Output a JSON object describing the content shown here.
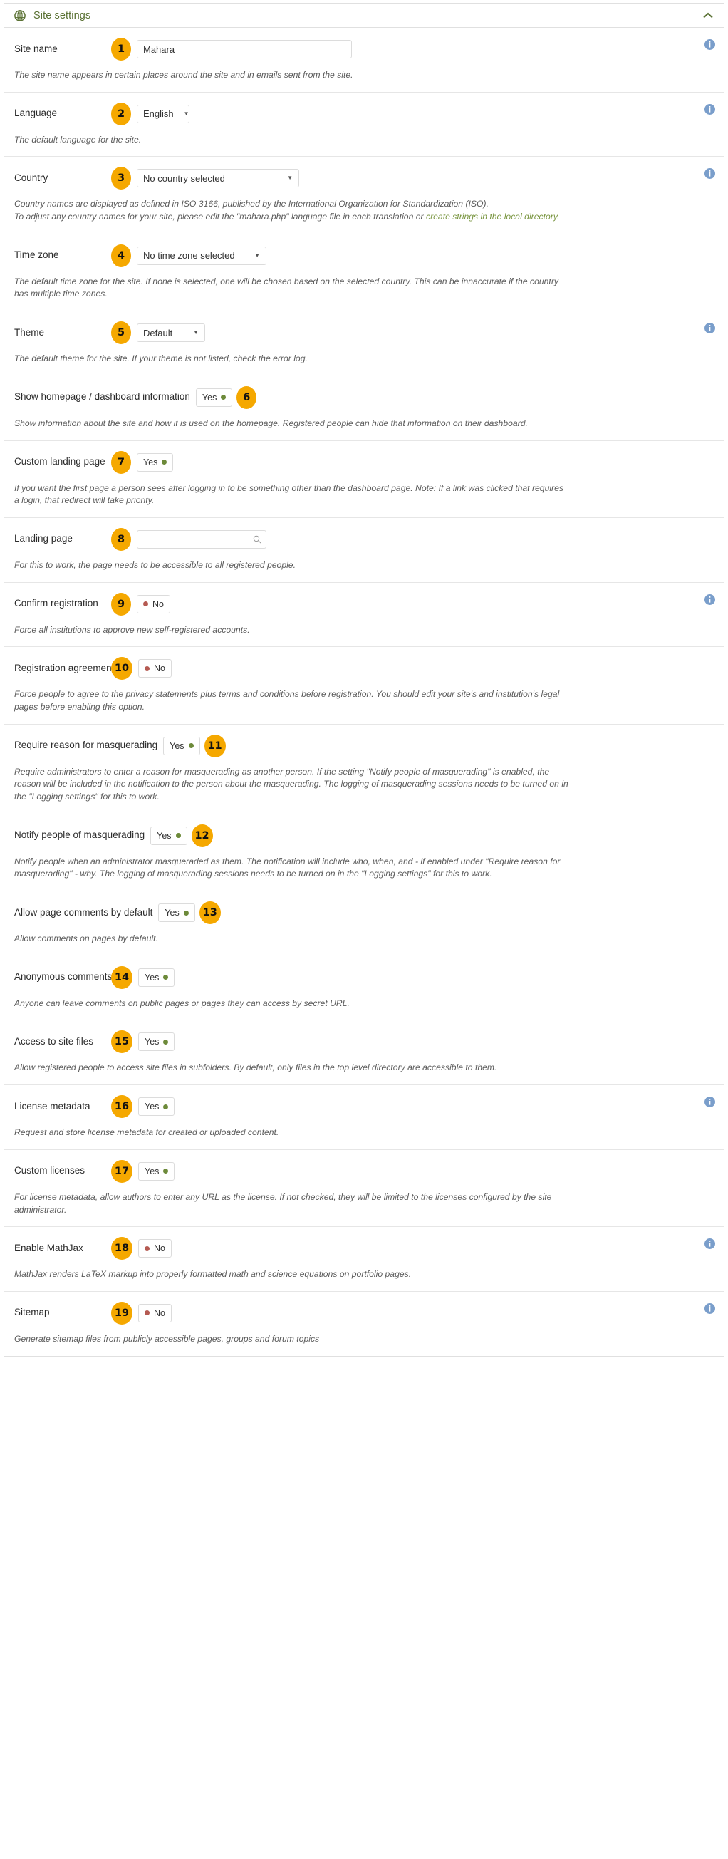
{
  "header": {
    "title": "Site settings",
    "globe_icon": "globe-icon",
    "collapse_icon": "chevron-up-icon"
  },
  "icons": {
    "info": "info-icon",
    "search": "search-icon",
    "caret": "▼"
  },
  "rows": [
    {
      "badge": "1",
      "label": "Site name",
      "control": "text",
      "value": "Mahara",
      "placeholder": "",
      "info": true,
      "help": "The site name appears in certain places around the site and in emails sent from the site."
    },
    {
      "badge": "2",
      "label": "Language",
      "control": "select",
      "value": "English",
      "info": true,
      "help": "The default language for the site."
    },
    {
      "badge": "3",
      "label": "Country",
      "control": "select",
      "value": "No country selected",
      "info": true,
      "help_part1": "Country names are displayed as defined in ISO 3166, published by the International Organization for Standardization (ISO).",
      "help_part2": "To adjust any country names for your site, please edit the \"mahara.php\" language file in each translation or ",
      "help_link": "create strings in the local directory",
      "help_part3": "."
    },
    {
      "badge": "4",
      "label": "Time zone",
      "control": "select",
      "value": "No time zone selected",
      "info": false,
      "help": "The default time zone for the site. If none is selected, one will be chosen based on the selected country. This can be innaccurate if the country has multiple time zones."
    },
    {
      "badge": "5",
      "label": "Theme",
      "control": "select",
      "value": "Default",
      "info": true,
      "help": "The default theme for the site. If your theme is not listed, check the error log."
    },
    {
      "badge": "6",
      "label": "Show homepage / dashboard information",
      "control": "toggle",
      "value": "Yes",
      "state": "on",
      "badge_after": true,
      "info": false,
      "help": "Show information about the site and how it is used on the homepage. Registered people can hide that information on their dashboard."
    },
    {
      "badge": "7",
      "label": "Custom landing page",
      "control": "toggle",
      "value": "Yes",
      "state": "on",
      "info": false,
      "help": "If you want the first page a person sees after logging in to be something other than the dashboard page. Note: If a link was clicked that requires a login, that redirect will take priority."
    },
    {
      "badge": "8",
      "label": "Landing page",
      "control": "search",
      "value": "",
      "placeholder": "",
      "info": false,
      "help": "For this to work, the page needs to be accessible to all registered people."
    },
    {
      "badge": "9",
      "label": "Confirm registration",
      "control": "toggle",
      "value": "No",
      "state": "off",
      "info": true,
      "help": "Force all institutions to approve new self-registered accounts."
    },
    {
      "badge": "10",
      "label": "Registration agreement",
      "control": "toggle",
      "value": "No",
      "state": "off",
      "info": false,
      "help": "Force people to agree to the privacy statements plus terms and conditions before registration. You should edit your site's and institution's legal pages before enabling this option."
    },
    {
      "badge": "11",
      "label": "Require reason for masquerading",
      "control": "toggle",
      "value": "Yes",
      "state": "on",
      "badge_after": true,
      "info": false,
      "help": "Require administrators to enter a reason for masquerading as another person. If the setting \"Notify people of masquerading\" is enabled, the reason will be included in the notification to the person about the masquerading. The logging of masquerading sessions needs to be turned on in the \"Logging settings\" for this to work."
    },
    {
      "badge": "12",
      "label": "Notify people of masquerading",
      "control": "toggle",
      "value": "Yes",
      "state": "on",
      "badge_after": true,
      "info": false,
      "help": "Notify people when an administrator masqueraded as them. The notification will include who, when, and - if enabled under \"Require reason for masquerading\" - why. The logging of masquerading sessions needs to be turned on in the \"Logging settings\" for this to work."
    },
    {
      "badge": "13",
      "label": "Allow page comments by default",
      "control": "toggle",
      "value": "Yes",
      "state": "on",
      "badge_after": true,
      "info": false,
      "help": "Allow comments on pages by default."
    },
    {
      "badge": "14",
      "label": "Anonymous comments",
      "control": "toggle",
      "value": "Yes",
      "state": "on",
      "info": false,
      "help": "Anyone can leave comments on public pages or pages they can access by secret URL."
    },
    {
      "badge": "15",
      "label": "Access to site files",
      "control": "toggle",
      "value": "Yes",
      "state": "on",
      "info": false,
      "help": "Allow registered people to access site files in subfolders. By default, only files in the top level directory are accessible to them."
    },
    {
      "badge": "16",
      "label": "License metadata",
      "control": "toggle",
      "value": "Yes",
      "state": "on",
      "info": true,
      "help": "Request and store license metadata for created or uploaded content."
    },
    {
      "badge": "17",
      "label": "Custom licenses",
      "control": "toggle",
      "value": "Yes",
      "state": "on",
      "info": false,
      "help": "For license metadata, allow authors to enter any URL as the license. If not checked, they will be limited to the licenses configured by the site administrator."
    },
    {
      "badge": "18",
      "label": "Enable MathJax",
      "control": "toggle",
      "value": "No",
      "state": "off",
      "info": true,
      "help": "MathJax renders LaTeX markup into properly formatted math and science equations on portfolio pages."
    },
    {
      "badge": "19",
      "label": "Sitemap",
      "control": "toggle",
      "value": "No",
      "state": "off",
      "info": true,
      "help": "Generate sitemap files from publicly accessible pages, groups and forum topics"
    }
  ],
  "colors": {
    "accent_green": "#5a7133",
    "badge_orange": "#f5a800",
    "info_blue": "#7a9ecb",
    "dot_on": "#6d8a3a",
    "dot_off": "#b55a52",
    "link_green": "#7a9641"
  }
}
